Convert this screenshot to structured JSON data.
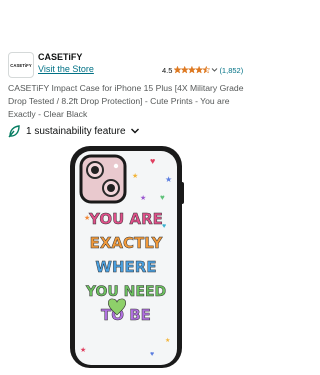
{
  "brand": {
    "logo_text": "CASETiFY",
    "name": "CASETiFY",
    "store_link": "Visit the Store"
  },
  "rating": {
    "value": "4.5",
    "stars": 4.5,
    "count": "(1,852)",
    "star_color": "#de7921"
  },
  "product": {
    "title": "CASETiFY Impact Case for iPhone 15 Plus [4X Military Grade Drop Tested / 8.2ft Drop Protection] - Cute Prints - You are Exactly - Clear Black",
    "image_text": [
      "YOU ARE",
      "EXACTLY",
      "WHERE",
      "YOU NEED",
      "TO BE"
    ]
  },
  "sustainability": {
    "label": "1 sustainability feature",
    "icon": "leaf-icon",
    "accent": "#067d62"
  },
  "colors": {
    "link": "#007185",
    "text": "#0f1111",
    "muted": "#565959"
  }
}
